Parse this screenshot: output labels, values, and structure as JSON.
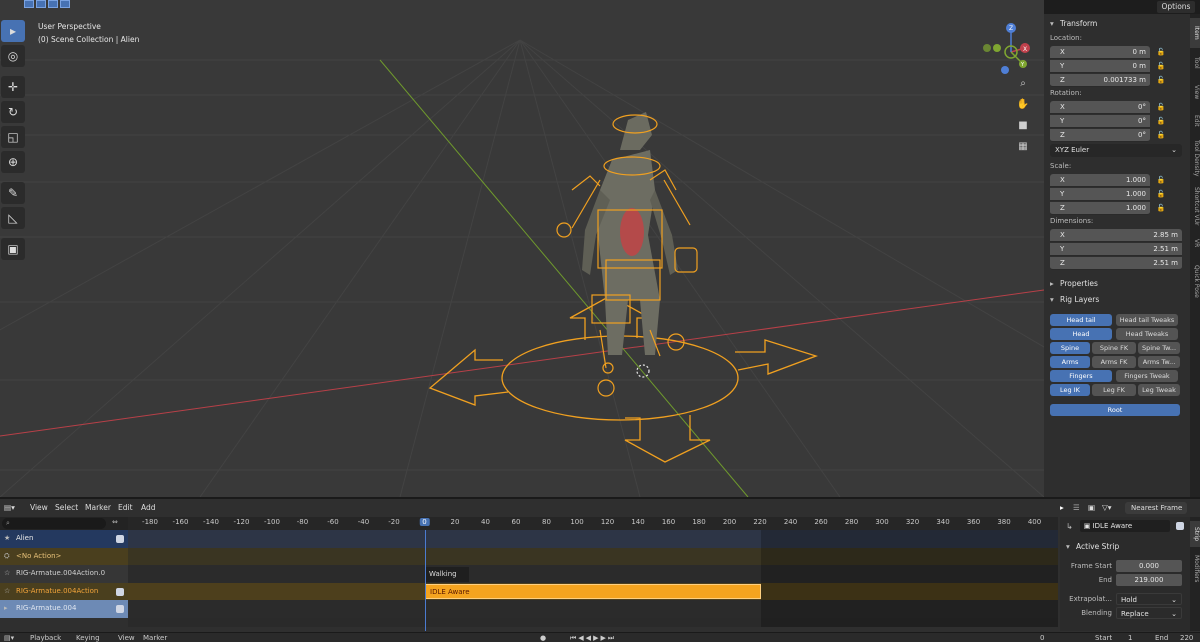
{
  "viewport": {
    "view_name": "User Perspective",
    "collection_path": "(0) Scene Collection | Alien",
    "tools": [
      "select-box",
      "cursor",
      "move",
      "rotate",
      "scale",
      "transform",
      "annotate",
      "measure",
      "add-cube"
    ],
    "gizmo_axes": [
      "X",
      "Y",
      "Z"
    ],
    "colors": {
      "background": "#393939",
      "x_axis": "#c1414c",
      "y_axis": "#7fa631",
      "rig": "#f0a020",
      "active_blue": "#4772b3"
    }
  },
  "header": {
    "options_label": "Options"
  },
  "sidebar": {
    "transform_title": "Transform",
    "location_label": "Location:",
    "location": [
      {
        "axis": "X",
        "value": "0 m"
      },
      {
        "axis": "Y",
        "value": "0 m"
      },
      {
        "axis": "Z",
        "value": "0.001733 m"
      }
    ],
    "rotation_label": "Rotation:",
    "rotation": [
      {
        "axis": "X",
        "value": "0°"
      },
      {
        "axis": "Y",
        "value": "0°"
      },
      {
        "axis": "Z",
        "value": "0°"
      }
    ],
    "rotation_mode": "XYZ Euler",
    "scale_label": "Scale:",
    "scale": [
      {
        "axis": "X",
        "value": "1.000"
      },
      {
        "axis": "Y",
        "value": "1.000"
      },
      {
        "axis": "Z",
        "value": "1.000"
      }
    ],
    "dimensions_label": "Dimensions:",
    "dimensions": [
      {
        "axis": "X",
        "value": "2.85 m"
      },
      {
        "axis": "Y",
        "value": "2.51 m"
      },
      {
        "axis": "Z",
        "value": "2.51 m"
      }
    ],
    "properties_title": "Properties",
    "rig_layers_title": "Rig Layers",
    "rig_layers": {
      "head_tail": "Head tail",
      "head_tail_tweaks": "Head tail Tweaks",
      "head": "Head",
      "head_tweaks": "Head Tweaks",
      "spine": "Spine",
      "spine_fk": "Spine FK",
      "spine_tw": "Spine Tw...",
      "arms": "Arms",
      "arms_fk": "Arms FK",
      "arms_tw": "Arms Tw...",
      "fingers": "Fingers",
      "fingers_tweak": "Fingers Tweak",
      "leg_ik": "Leg IK",
      "leg_fk": "Leg FK",
      "leg_tweak": "Leg Tweak",
      "root": "Root"
    },
    "tabs": [
      "Item",
      "Tool",
      "View",
      "Edit",
      "Tool Density",
      "Shortcut VUr",
      "VR",
      "Quick Pose"
    ]
  },
  "nla": {
    "menu": [
      "View",
      "Select",
      "Marker",
      "Edit",
      "Add"
    ],
    "snap_mode": "Nearest Frame",
    "ruler_ticks": [
      "-180",
      "-160",
      "-140",
      "-120",
      "-100",
      "-80",
      "-60",
      "-40",
      "-20",
      "0",
      "20",
      "40",
      "60",
      "80",
      "100",
      "120",
      "140",
      "160",
      "180",
      "200",
      "220",
      "240",
      "260",
      "280",
      "300",
      "320",
      "340",
      "360",
      "380",
      "400"
    ],
    "current_frame": "0",
    "channels": {
      "object": "Alien",
      "no_action": "<No Action>",
      "track1": "RIG-Armatue.004Action.0",
      "track2": "RIG-Armatue.004Action",
      "track3": "RIG-Armatue.004"
    },
    "strips": {
      "walking": "Walking",
      "idle": "IDLE Aware"
    },
    "active_strip_name": "IDLE Aware",
    "active_strip_title": "Active Strip",
    "frame_start_label": "Frame Start",
    "frame_start": "0.000",
    "end_label": "End",
    "end": "219.000",
    "extrapolation_label": "Extrapolat...",
    "extrapolation": "Hold",
    "blending_label": "Blending",
    "blending": "Replace",
    "side_tabs": [
      "Strip",
      "Modifiers"
    ]
  },
  "timeline": {
    "playback": "Playback",
    "keying": "Keying",
    "view": "View",
    "marker": "Marker",
    "frame": "0",
    "start_label": "Start",
    "start": "1",
    "end_label": "End",
    "end": "220"
  }
}
